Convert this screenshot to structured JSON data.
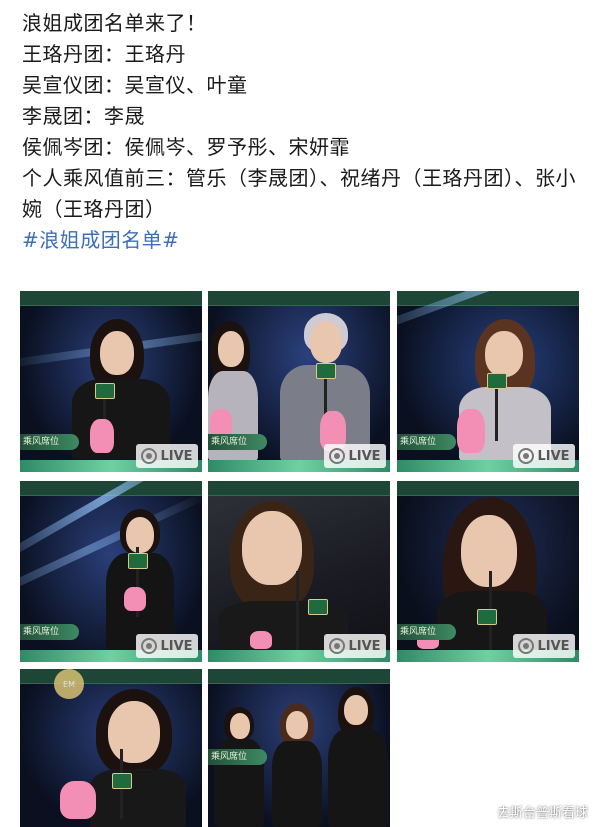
{
  "post": {
    "lines": [
      "浪姐成团名单来了！",
      "王珞丹团：王珞丹",
      "吴宣仪团：吴宣仪、叶童",
      "李晟团：李晟",
      "侯佩岑团：侯佩岑、罗予彤、宋妍霏",
      "个人乘风值前三：管乐（李晟团）、祝绪丹（王珞丹团）、张小婉（王珞丹团）"
    ],
    "hashtag": "#浪姐成团名单#"
  },
  "photos": {
    "live_label": "LIVE",
    "banner_text": "乘风席位",
    "badge_text": "EM"
  },
  "watermark": "去斯台普斯看球",
  "colors": {
    "hashtag": "#3d6fb6",
    "stage_green": "#2f8a66",
    "banner_green": "#234f3a"
  }
}
